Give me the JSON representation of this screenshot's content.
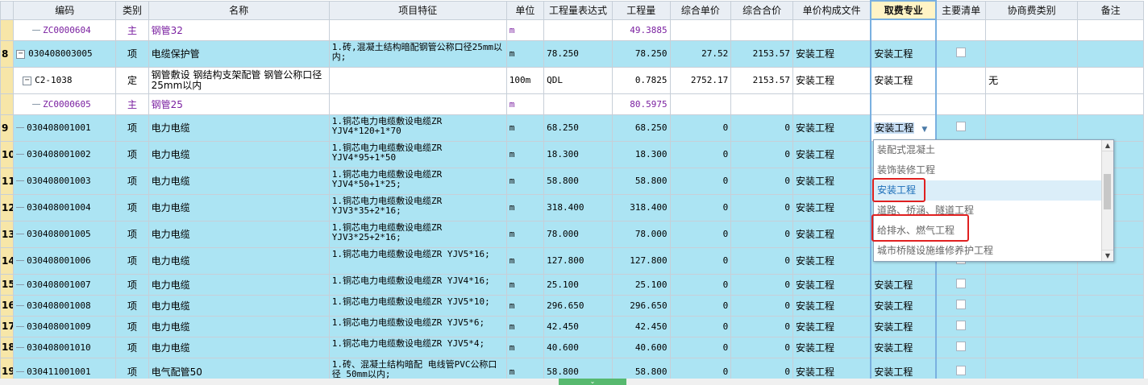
{
  "columns": [
    "",
    "编码",
    "类别",
    "名称",
    "项目特征",
    "单位",
    "工程量表达式",
    "工程量",
    "综合单价",
    "综合合价",
    "单价构成文件",
    "取费专业",
    "主要清单",
    "协商费类别",
    "备注"
  ],
  "rows": [
    {
      "rn": "",
      "style": "white",
      "level": 2,
      "code": "ZC0000604",
      "code_is_zc": true,
      "type": "主",
      "name": "钢管32",
      "purple": true,
      "feature": "",
      "unit": "m",
      "expr": "",
      "qty": "49.3885",
      "uprice": "",
      "total": "",
      "file": "",
      "fee": "",
      "main": false,
      "negcat": "",
      "note": ""
    },
    {
      "rn": "8",
      "style": "blue",
      "level": 0,
      "toggle": "−",
      "code": "030408003005",
      "type": "项",
      "name": "电缆保护管",
      "feature": "1.砖,混凝土结构暗配钢管公称口径25mm以内;",
      "unit": "m",
      "expr": "78.250",
      "qty": "78.250",
      "uprice": "27.52",
      "total": "2153.57",
      "file": "安装工程",
      "fee": "安装工程",
      "main": true,
      "negcat": "",
      "note": ""
    },
    {
      "rn": "",
      "style": "white",
      "level": 1,
      "toggle": "−",
      "code": "C2-1038",
      "type": "定",
      "name": "钢管敷设 钢结构支架配管 钢管公称口径25mm以内",
      "feature": "",
      "unit": "100m",
      "expr": "QDL",
      "qty": "0.7825",
      "uprice": "2752.17",
      "total": "2153.57",
      "file": "安装工程",
      "fee": "安装工程",
      "main": false,
      "negcat": "无",
      "note": ""
    },
    {
      "rn": "",
      "style": "white",
      "level": 2,
      "code": "ZC0000605",
      "code_is_zc": true,
      "type": "主",
      "name": "钢管25",
      "purple": true,
      "feature": "",
      "unit": "m",
      "expr": "",
      "qty": "80.5975",
      "uprice": "",
      "total": "",
      "file": "",
      "fee": "",
      "main": false,
      "negcat": "",
      "note": ""
    },
    {
      "rn": "9",
      "style": "blue",
      "level": 0,
      "code": "030408001001",
      "type": "项",
      "name": "电力电缆",
      "feature": "1.铜芯电力电缆敷设电缆ZR YJV4*120+1*70",
      "unit": "m",
      "expr": "68.250",
      "qty": "68.250",
      "uprice": "0",
      "total": "0",
      "file": "安装工程",
      "fee": "安装工程",
      "fee_selected": true,
      "main": true,
      "negcat": "",
      "note": ""
    },
    {
      "rn": "10",
      "style": "blue",
      "level": 0,
      "code": "030408001002",
      "type": "项",
      "name": "电力电缆",
      "feature": "1.铜芯电力电缆敷设电缆ZR YJV4*95+1*50",
      "unit": "m",
      "expr": "18.300",
      "qty": "18.300",
      "uprice": "0",
      "total": "0",
      "file": "安装工程",
      "fee": "",
      "main": true,
      "negcat": "",
      "note": ""
    },
    {
      "rn": "11",
      "style": "blue",
      "level": 0,
      "code": "030408001003",
      "type": "项",
      "name": "电力电缆",
      "feature": "1.铜芯电力电缆敷设电缆ZR YJV4*50+1*25;",
      "unit": "m",
      "expr": "58.800",
      "qty": "58.800",
      "uprice": "0",
      "total": "0",
      "file": "安装工程",
      "fee": "",
      "main": true,
      "negcat": "",
      "note": ""
    },
    {
      "rn": "12",
      "style": "blue",
      "level": 0,
      "code": "030408001004",
      "type": "项",
      "name": "电力电缆",
      "feature": "1.铜芯电力电缆敷设电缆ZR YJV3*35+2*16;",
      "unit": "m",
      "expr": "318.400",
      "qty": "318.400",
      "uprice": "0",
      "total": "0",
      "file": "安装工程",
      "fee": "",
      "main": true,
      "negcat": "",
      "note": ""
    },
    {
      "rn": "13",
      "style": "blue",
      "level": 0,
      "code": "030408001005",
      "type": "项",
      "name": "电力电缆",
      "feature": "1.铜芯电力电缆敷设电缆ZR YJV3*25+2*16;",
      "unit": "m",
      "expr": "78.000",
      "qty": "78.000",
      "uprice": "0",
      "total": "0",
      "file": "安装工程",
      "fee": "",
      "main": true,
      "negcat": "",
      "note": ""
    },
    {
      "rn": "14",
      "style": "blue",
      "level": 0,
      "code": "030408001006",
      "type": "项",
      "name": "电力电缆",
      "feature": "1.铜芯电力电缆敷设电缆ZR YJV5*16;",
      "unit": "m",
      "expr": "127.800",
      "qty": "127.800",
      "uprice": "0",
      "total": "0",
      "file": "安装工程",
      "fee": "",
      "main": true,
      "negcat": "",
      "note": ""
    },
    {
      "rn": "15",
      "style": "blue",
      "level": 0,
      "code": "030408001007",
      "type": "项",
      "name": "电力电缆",
      "feature": "1.铜芯电力电缆敷设电缆ZR YJV4*16;",
      "unit": "m",
      "expr": "25.100",
      "qty": "25.100",
      "uprice": "0",
      "total": "0",
      "file": "安装工程",
      "fee": "安装工程",
      "main": true,
      "negcat": "",
      "note": ""
    },
    {
      "rn": "16",
      "style": "blue",
      "level": 0,
      "code": "030408001008",
      "type": "项",
      "name": "电力电缆",
      "feature": "1.铜芯电力电缆敷设电缆ZR YJV5*10;",
      "unit": "m",
      "expr": "296.650",
      "qty": "296.650",
      "uprice": "0",
      "total": "0",
      "file": "安装工程",
      "fee": "安装工程",
      "main": true,
      "negcat": "",
      "note": ""
    },
    {
      "rn": "17",
      "style": "blue",
      "level": 0,
      "code": "030408001009",
      "type": "项",
      "name": "电力电缆",
      "feature": "1.铜芯电力电缆敷设电缆ZR YJV5*6;",
      "unit": "m",
      "expr": "42.450",
      "qty": "42.450",
      "uprice": "0",
      "total": "0",
      "file": "安装工程",
      "fee": "安装工程",
      "main": true,
      "negcat": "",
      "note": ""
    },
    {
      "rn": "18",
      "style": "blue",
      "level": 0,
      "code": "030408001010",
      "type": "项",
      "name": "电力电缆",
      "feature": "1.铜芯电力电缆敷设电缆ZR YJV5*4;",
      "unit": "m",
      "expr": "40.600",
      "qty": "40.600",
      "uprice": "0",
      "total": "0",
      "file": "安装工程",
      "fee": "安装工程",
      "main": true,
      "negcat": "",
      "note": ""
    },
    {
      "rn": "19",
      "style": "blue",
      "level": 0,
      "code": "030411001001",
      "type": "项",
      "name": "电气配管50",
      "feature": "1.砖、混凝土结构暗配 电线管PVC公称口径 50mm以内;",
      "unit": "m",
      "expr": "58.800",
      "qty": "58.800",
      "uprice": "0",
      "total": "0",
      "file": "安装工程",
      "fee": "安装工程",
      "main": true,
      "negcat": "",
      "note": ""
    }
  ],
  "dropdown": {
    "items": [
      "装配式混凝土",
      "装饰装修工程",
      "安装工程",
      "道路、桥涵、隧道工程",
      "给排水、燃气工程",
      "城市桥隧设施维修养护工程"
    ],
    "selected_index": 2
  },
  "colors": {
    "row_blue": "#ace4f3",
    "row_number": "#f7e6a8",
    "header": "#e9eef4",
    "highlight_border": "#e02020",
    "zc_text": "#7a1fa0"
  }
}
